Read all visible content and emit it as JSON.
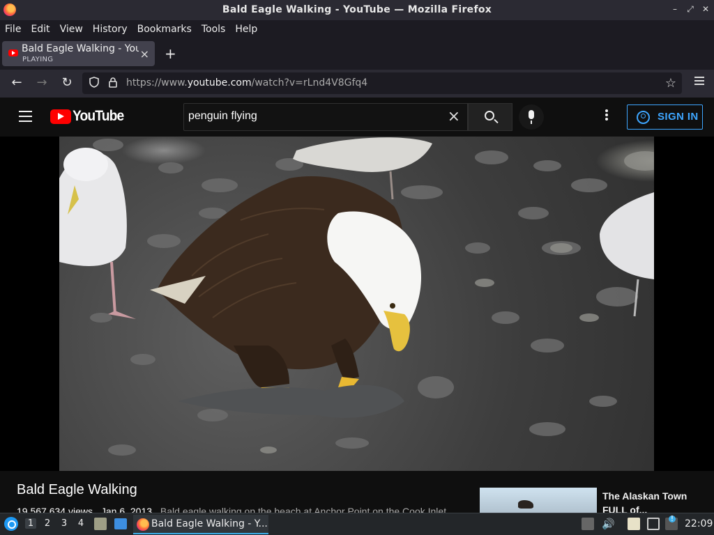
{
  "window": {
    "title": "Bald Eagle Walking - YouTube — Mozilla Firefox",
    "buttons": {
      "minimize": "–",
      "restore": "⤢",
      "close": "✕"
    }
  },
  "menubar": {
    "items": [
      {
        "label": "File"
      },
      {
        "label": "Edit"
      },
      {
        "label": "View"
      },
      {
        "label": "History"
      },
      {
        "label": "Bookmarks"
      },
      {
        "label": "Tools"
      },
      {
        "label": "Help"
      }
    ]
  },
  "tabs": [
    {
      "title": "Bald Eagle Walking - YouTube",
      "status": "PLAYING",
      "close": "×"
    }
  ],
  "newtab_label": "+",
  "nav": {
    "back": "←",
    "forward": "→",
    "reload": "↻",
    "url_prefix": "https://www.",
    "url_host": "youtube.com",
    "url_path": "/watch?v=rLnd4V8Gfq4",
    "bookmark": "☆"
  },
  "youtube": {
    "logo_text": "YouTube",
    "search": {
      "value": "penguin flying",
      "clear": "×"
    },
    "sign_in": "SIGN IN"
  },
  "video": {
    "title": "Bald Eagle Walking",
    "views": "19,567,634 views",
    "date": "Jan 6, 2013",
    "description": "Bald eagle walking on the beach at Anchor Point on the Cook Inlet..."
  },
  "related": [
    {
      "title": "The Alaskan Town FULL of..."
    }
  ],
  "taskbar": {
    "workspaces": [
      "1",
      "2",
      "3",
      "4"
    ],
    "active_task": "Bald Eagle Walking - Y...",
    "volume_icon": "🔊",
    "clock": "22:09"
  },
  "colors": {
    "yt_red": "#ff0000",
    "sign_in_blue": "#3ea6ff",
    "firefox_chrome": "#2b2a33",
    "taskbar_accent": "#3daee9"
  },
  "icons": [
    "firefox-icon",
    "back-icon",
    "forward-icon",
    "reload-icon",
    "shield-icon",
    "lock-icon",
    "star-icon",
    "menu-icon",
    "youtube-logo-icon",
    "search-icon",
    "mic-icon",
    "more-icon",
    "user-icon"
  ]
}
